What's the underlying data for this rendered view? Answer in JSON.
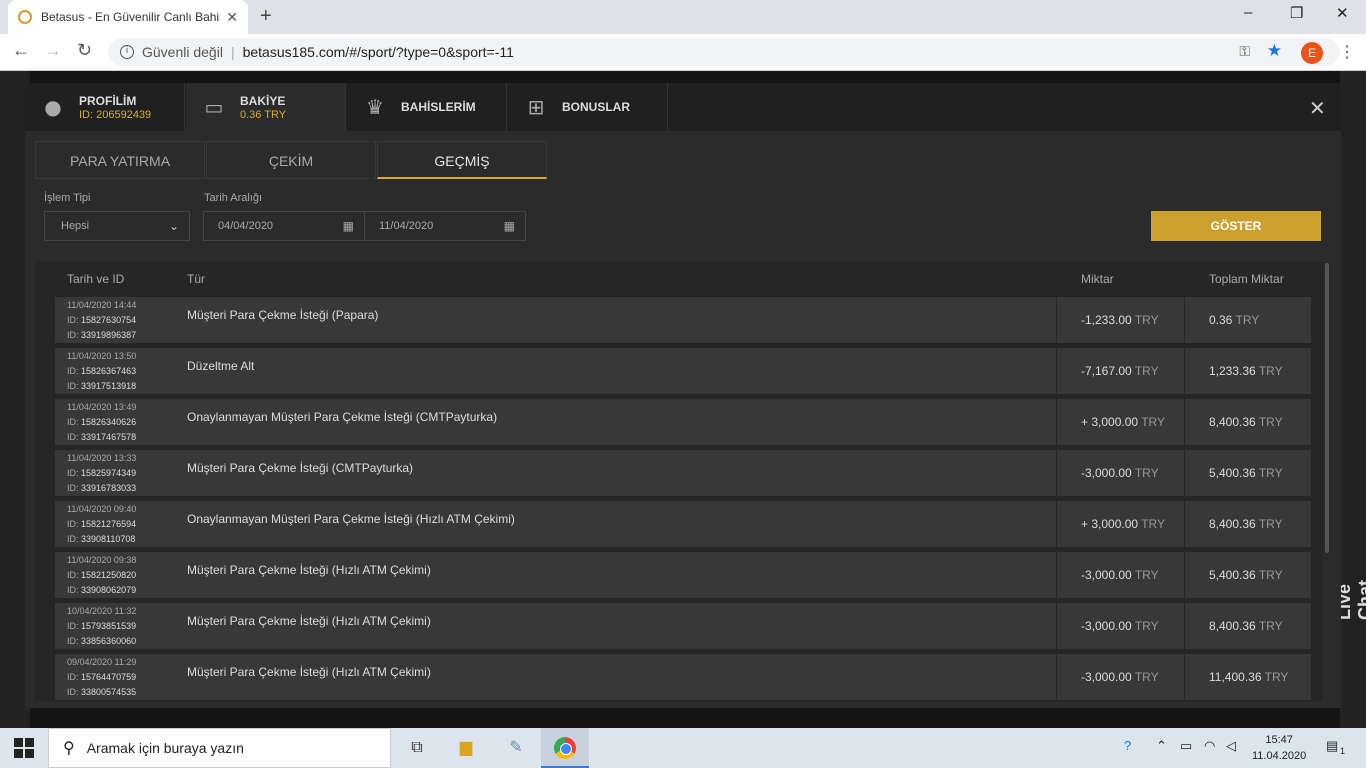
{
  "browser": {
    "tab_title": "Betasus - En Güvenilir Canlı Bahis",
    "tab_close": "✕",
    "new_tab": "+",
    "security_label": "Güvenli değil",
    "url": "betasus185.com/#/sport/?type=0&sport=-11",
    "profile_initial": "E",
    "window_controls": [
      "–",
      "❐",
      "✕"
    ]
  },
  "modal": {
    "tabs": [
      {
        "icon": "user-icon",
        "label": "PROFİLİM",
        "sub": "ID: 206592439"
      },
      {
        "icon": "wallet-icon",
        "label": "BAKİYE",
        "sub": "0.36 TRY"
      },
      {
        "icon": "trophy-icon",
        "label": "BAHİSLERİM",
        "sub": ""
      },
      {
        "icon": "gift-icon",
        "label": "BONUSLAR",
        "sub": ""
      }
    ],
    "active_tab": "BAKİYE",
    "close": "✕",
    "subtabs": [
      "PARA YATIRMA",
      "ÇEKİM",
      "GEÇMİŞ"
    ],
    "active_subtab": "GEÇMİŞ",
    "filters": {
      "type_label": "İşlem Tipi",
      "type_value": "Hepsi",
      "date_label": "Tarih Aralığı",
      "date_from": "04/04/2020",
      "date_to": "11/04/2020",
      "show_button": "GÖSTER"
    },
    "table": {
      "headers": [
        "Tarih ve ID",
        "Tür",
        "Miktar",
        "Toplam Miktar"
      ],
      "id_prefix": "ID:",
      "currency": "TRY",
      "rows": [
        {
          "date": "11/04/2020 14:44",
          "id1": "15827630754",
          "id2": "33919896387",
          "type": "Müşteri Para Çekme İsteği (Papara)",
          "amount": "-1,233.00",
          "total": "0.36"
        },
        {
          "date": "11/04/2020 13:50",
          "id1": "15826367463",
          "id2": "33917513918",
          "type": "Düzeltme Alt",
          "amount": "-7,167.00",
          "total": "1,233.36"
        },
        {
          "date": "11/04/2020 13:49",
          "id1": "15826340626",
          "id2": "33917467578",
          "type": "Onaylanmayan Müşteri Para Çekme İsteği (CMTPayturka)",
          "amount": "+ 3,000.00",
          "total": "8,400.36"
        },
        {
          "date": "11/04/2020 13:33",
          "id1": "15825974349",
          "id2": "33916783033",
          "type": "Müşteri Para Çekme İsteği (CMTPayturka)",
          "amount": "-3,000.00",
          "total": "5,400.36"
        },
        {
          "date": "11/04/2020 09:40",
          "id1": "15821276594",
          "id2": "33908110708",
          "type": "Onaylanmayan Müşteri Para Çekme İsteği (Hızlı ATM Çekimi)",
          "amount": "+ 3,000.00",
          "total": "8,400.36"
        },
        {
          "date": "11/04/2020 09:38",
          "id1": "15821250820",
          "id2": "33908062079",
          "type": "Müşteri Para Çekme İsteği (Hızlı ATM Çekimi)",
          "amount": "-3,000.00",
          "total": "5,400.36"
        },
        {
          "date": "10/04/2020 11:32",
          "id1": "15793851539",
          "id2": "33856360060",
          "type": "Müşteri Para Çekme İsteği (Hızlı ATM Çekimi)",
          "amount": "-3,000.00",
          "total": "8,400.36"
        },
        {
          "date": "09/04/2020 11:29",
          "id1": "15764470759",
          "id2": "33800574535",
          "type": "Müşteri Para Çekme İsteği (Hızlı ATM Çekimi)",
          "amount": "-3,000.00",
          "total": "11,400.36"
        }
      ]
    }
  },
  "site": {
    "live_chat": "Live Chat"
  },
  "taskbar": {
    "search_placeholder": "Aramak için buraya yazın",
    "time": "15:47",
    "date": "11.04.2020",
    "notification_count": "1"
  },
  "colors": {
    "accent": "#cda02e",
    "modal_bg": "#2b2b2b",
    "row_bg": "#383838"
  }
}
